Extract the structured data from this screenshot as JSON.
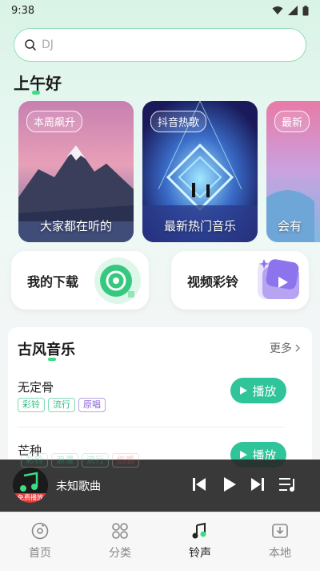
{
  "status_bar": {
    "time": "9:38"
  },
  "search": {
    "placeholder": "DJ"
  },
  "greeting": "上午好",
  "cards": [
    {
      "tag": "本周飙升",
      "caption": "大家都在听的"
    },
    {
      "tag": "抖音热歌",
      "caption": "最新热门音乐"
    },
    {
      "tag": "最新",
      "caption": "会有"
    }
  ],
  "quick_actions": [
    {
      "label": "我的下载",
      "icon": "disc-download-icon"
    },
    {
      "label": "视频彩铃",
      "icon": "video-play-icon"
    }
  ],
  "section": {
    "title": "古风音乐",
    "more": "更多",
    "songs": [
      {
        "name": "无定骨",
        "tags": [
          "彩铃",
          "流行",
          "原唱"
        ],
        "play": "播放"
      },
      {
        "name": "芒种",
        "tags": [
          "彩铃",
          "浪漫",
          "流行",
          "伤感"
        ],
        "play": "播放"
      }
    ]
  },
  "player": {
    "title": "未知歌曲",
    "cover_label": "免费播放"
  },
  "tabs": [
    {
      "label": "首页",
      "icon": "music-disc-icon"
    },
    {
      "label": "分类",
      "icon": "grid-icon"
    },
    {
      "label": "铃声",
      "icon": "ringtone-icon",
      "active": true
    },
    {
      "label": "本地",
      "icon": "local-download-icon"
    }
  ],
  "colors": {
    "accent": "#2fc49a",
    "tab_active": "#222222"
  }
}
